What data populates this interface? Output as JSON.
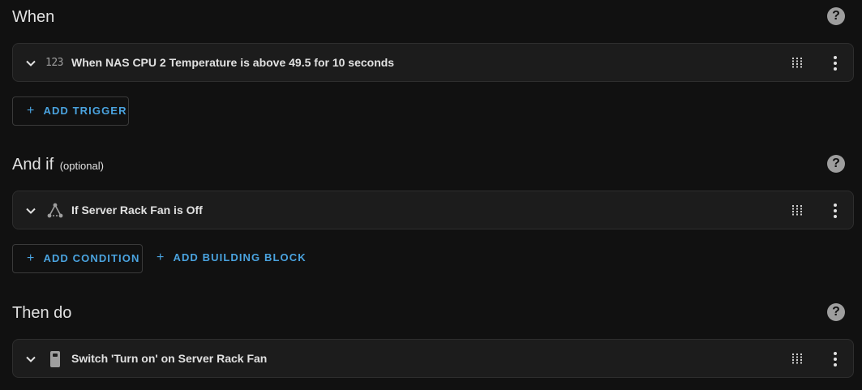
{
  "when": {
    "title": "When",
    "help_icon": "help-circle-icon",
    "trigger": {
      "icon_text": "123",
      "label": "When NAS CPU 2 Temperature is above 49.5 for 10 seconds"
    },
    "add_button": "ADD TRIGGER"
  },
  "and_if": {
    "title": "And if",
    "optional": "(optional)",
    "help_icon": "help-circle-icon",
    "condition": {
      "icon": "state-condition-icon",
      "label": "If Server Rack Fan is Off"
    },
    "add_condition_button": "ADD CONDITION",
    "add_building_block_button": "ADD BUILDING BLOCK"
  },
  "then_do": {
    "title": "Then do",
    "help_icon": "help-circle-icon",
    "action": {
      "icon": "switch-icon",
      "label": "Switch 'Turn on' on Server Rack Fan"
    }
  },
  "colors": {
    "background": "#111111",
    "card": "#1c1c1c",
    "accent": "#4aa3df",
    "icon": "#9e9e9e",
    "text": "#e1e1e1"
  },
  "plus_glyph": "+",
  "help_glyph": "?"
}
